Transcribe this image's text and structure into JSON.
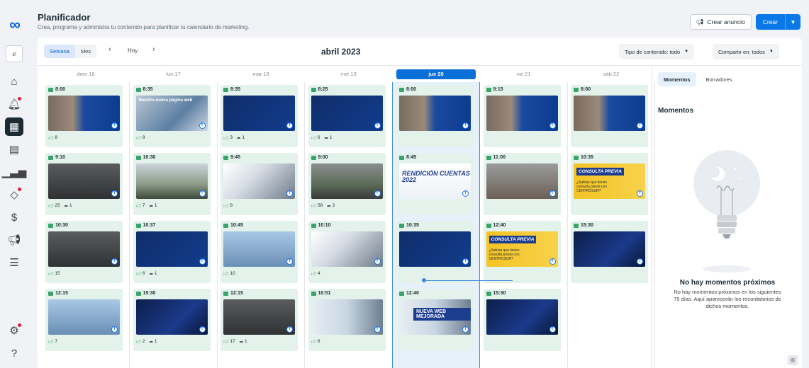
{
  "header": {
    "title": "Planificador",
    "subtitle": "Crea, programa y administra tu contenido para planificar tu calendario de marketing.",
    "create_ad": "Crear anuncio",
    "create": "Crear"
  },
  "toolbar": {
    "view_week": "Semana",
    "view_month": "Mes",
    "today": "Hoy",
    "month_title": "abril 2023",
    "content_type": "Tipo de contenido: todo",
    "share_in": "Compartir en: todos"
  },
  "days": [
    {
      "label": "dom 16",
      "today": false
    },
    {
      "label": "lun 17",
      "today": false
    },
    {
      "label": "mar 18",
      "today": false
    },
    {
      "label": "mié 19",
      "today": false
    },
    {
      "label": "jue 20",
      "today": true
    },
    {
      "label": "vie 21",
      "today": false
    },
    {
      "label": "sáb 22",
      "today": false
    }
  ],
  "posts": [
    [
      {
        "time": "8:00",
        "likes": "8",
        "shares": "",
        "theme": "office"
      },
      {
        "time": "9:10",
        "likes": "25",
        "shares": "1",
        "theme": "grey"
      },
      {
        "time": "10:30",
        "likes": "15",
        "shares": "",
        "theme": "grey"
      },
      {
        "time": "12:15",
        "likes": "7",
        "shares": "",
        "theme": "sky"
      }
    ],
    [
      {
        "time": "8:35",
        "likes": "8",
        "shares": "",
        "theme": "web",
        "overlay": "Nuestra nueva página web"
      },
      {
        "time": "10:30",
        "likes": "7",
        "shares": "1",
        "theme": "trees"
      },
      {
        "time": "10:37",
        "likes": "6",
        "shares": "1",
        "theme": "navy"
      },
      {
        "time": "15:30",
        "likes": "2",
        "shares": "1",
        "theme": "dark"
      }
    ],
    [
      {
        "time": "8:35",
        "likes": "3",
        "shares": "1",
        "theme": "navy"
      },
      {
        "time": "9:45",
        "likes": "8",
        "shares": "",
        "theme": "laptop"
      },
      {
        "time": "10:45",
        "likes": "10",
        "shares": "",
        "theme": "sky"
      },
      {
        "time": "12:15",
        "likes": "17",
        "shares": "1",
        "theme": "grey"
      }
    ],
    [
      {
        "time": "8:25",
        "likes": "6",
        "shares": "1",
        "theme": "navy"
      },
      {
        "time": "9:00",
        "likes": "58",
        "shares": "3",
        "theme": "street"
      },
      {
        "time": "10:10",
        "likes": "4",
        "shares": "",
        "theme": "laptop"
      },
      {
        "time": "10:51",
        "likes": "6",
        "shares": "",
        "theme": "people"
      }
    ],
    [
      {
        "time": "8:00",
        "likes": "",
        "shares": "",
        "theme": "office"
      },
      {
        "time": "8:45",
        "likes": "",
        "shares": "",
        "theme": "white",
        "rendicion": "RENDICIÓN CUENTAS 2022"
      },
      {
        "time": "10:35",
        "likes": "",
        "shares": "",
        "theme": "navy"
      },
      {
        "time": "12:40",
        "likes": "",
        "shares": "",
        "theme": "people",
        "newweb": "NUEVA WEB MEJORADA"
      }
    ],
    [
      {
        "time": "9:15",
        "likes": "",
        "shares": "",
        "theme": "office"
      },
      {
        "time": "11:00",
        "likes": "",
        "shares": "",
        "theme": "church"
      },
      {
        "time": "12:40",
        "likes": "",
        "shares": "",
        "theme": "yellow",
        "consulta": "CONSULTA PREVIA",
        "consulta_txt": "¿Sabías que tienes consulta previa con CENTROSUR?"
      },
      {
        "time": "15:30",
        "likes": "",
        "shares": "",
        "theme": "dark"
      }
    ],
    [
      {
        "time": "8:00",
        "likes": "",
        "shares": "",
        "theme": "office"
      },
      {
        "time": "10:35",
        "likes": "",
        "shares": "",
        "theme": "yellow",
        "consulta": "CONSULTA PREVIA",
        "consulta_txt": "¿Sabías que tienes consulta previa con CENTROSUR?"
      },
      {
        "time": "15:30",
        "likes": "",
        "shares": "",
        "theme": "dark"
      }
    ]
  ],
  "side": {
    "tab_moments": "Momentos",
    "tab_drafts": "Borradores",
    "heading": "Momentos",
    "empty_title": "No hay momentos próximos",
    "empty_desc": "No hay momentos próximos en los siguientes 75 días. Aquí aparecerán los recordatorios de dichos momentos."
  },
  "colors": {
    "accent": "#0a78e8",
    "today": "#0a6fd6",
    "card_bg": "#e3f2ea"
  }
}
